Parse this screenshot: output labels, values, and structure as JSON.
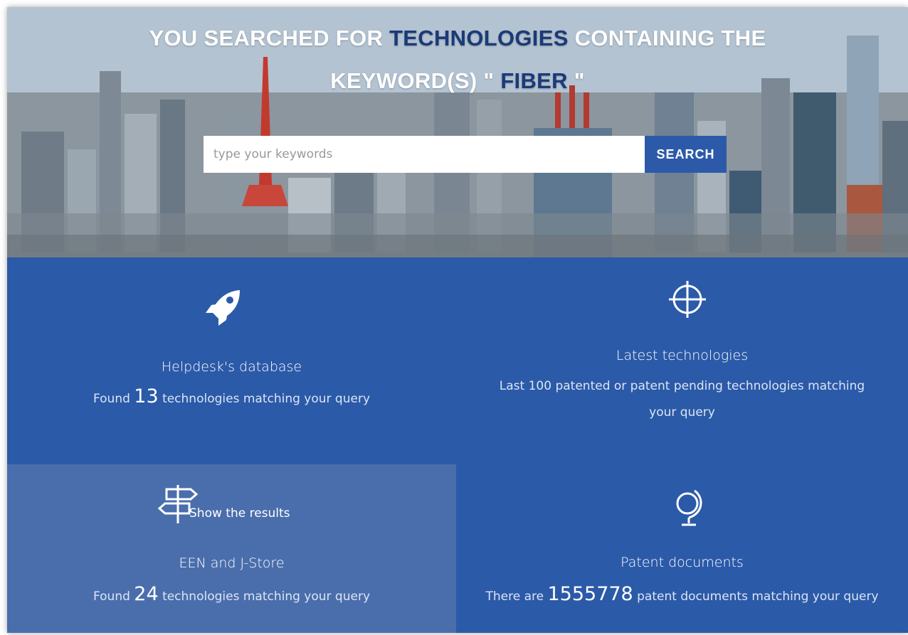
{
  "hero": {
    "title_prefix": "YOU SEARCHED FOR",
    "title_highlight": "TECHNOLOGIES",
    "title_middle": "CONTAINING THE",
    "title_line2_prefix": "KEYWORD(S) \"",
    "keyword": "FIBER",
    "title_line2_suffix": "\""
  },
  "search": {
    "placeholder": "type your keywords",
    "button_label": "SEARCH"
  },
  "panels": {
    "helpdesk": {
      "icon": "rocket-icon",
      "title": "Helpdesk's database",
      "desc_prefix": "Found",
      "count": "13",
      "desc_suffix": "technologies matching your query"
    },
    "latest": {
      "icon": "crosshair-icon",
      "title": "Latest technologies",
      "desc": "Last 100 patented or patent pending technologies matching your query"
    },
    "een": {
      "icon": "signpost-icon",
      "link": "Show the results",
      "title": "EEN and J-Store",
      "desc_prefix": "Found",
      "count": "24",
      "desc_suffix": "technologies matching your query"
    },
    "patents": {
      "icon": "globe-icon",
      "title": "Patent documents",
      "desc_prefix": "There are",
      "count": "1555778",
      "desc_suffix": "patent documents matching your query"
    }
  },
  "colors": {
    "panel_blue": "#2b5aa8",
    "panel_light": "#4a6eac",
    "highlight_text": "#1c3a78"
  }
}
